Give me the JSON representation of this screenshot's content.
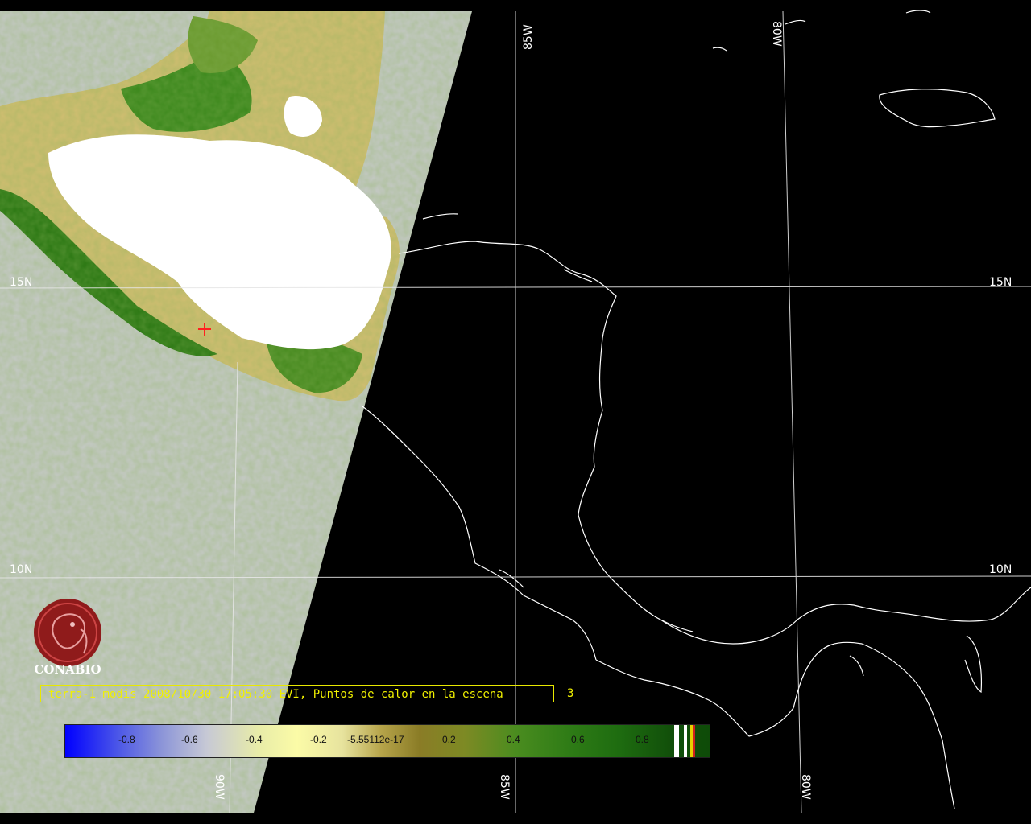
{
  "grid": {
    "lon_labels": [
      "85W",
      "80W",
      "90W",
      "85W",
      "80W"
    ],
    "lat_labels": [
      "15N",
      "15N",
      "10N",
      "10N"
    ]
  },
  "scene": {
    "caption": "terra-1 modis 2008/10/30 17:05:30 EVI, Puntos de calor en la escena",
    "hotspot_count": "3"
  },
  "legend": {
    "ticks": [
      "-0.8",
      "-0.6",
      "-0.4",
      "-0.2",
      "-5.55112e-17",
      "0.2",
      "0.4",
      "0.6",
      "0.8"
    ],
    "colors": {
      "low": "#0000ff",
      "mid": "#fbfba7",
      "high": "#0e4b08"
    }
  },
  "logo": {
    "text": "CONABIO",
    "icon": "conabio-parrot-logo"
  },
  "colors": {
    "no_data": "#c2c8c0",
    "cloud": "#ffffff",
    "vegetation": "#3a8a1e",
    "coastline": "#ffffff",
    "graticule": "#ffffff",
    "hotspot": "#ff2020",
    "caption": "#f0f000"
  }
}
